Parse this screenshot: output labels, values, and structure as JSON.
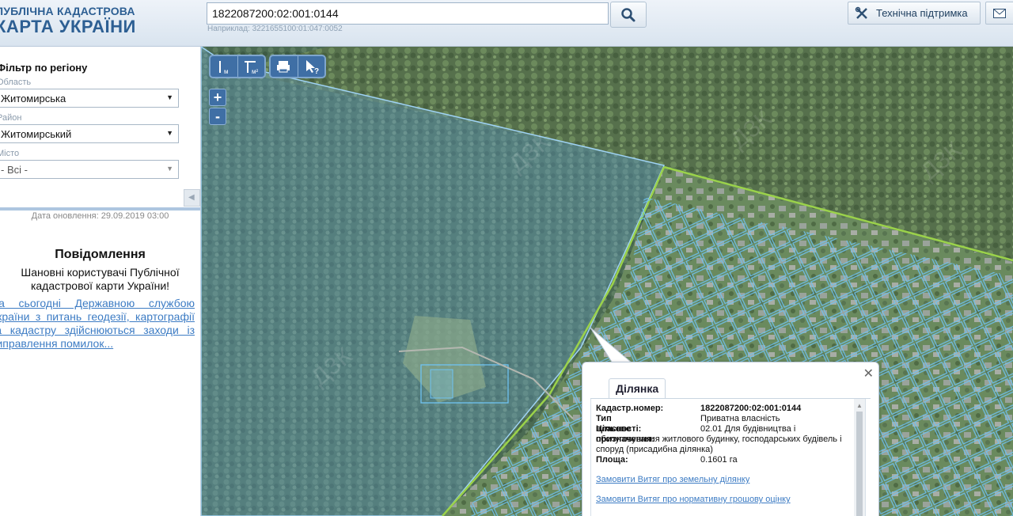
{
  "header": {
    "logo_line1": "ПУБЛІЧНА КАДАСТРОВА",
    "logo_line2": "КАРТА УКРАЇНИ",
    "search_value": "1822087200:02:001:0144",
    "search_hint": "Наприклад: 3221655100:01:047:0052",
    "support_label": "Технічна підтримка"
  },
  "sidebar": {
    "filter_title": "Фільтр по регіону",
    "oblast_label": "Область",
    "oblast_value": "Житомирська",
    "rayon_label": "Район",
    "rayon_value": "Житомирський",
    "misto_label": "Місто",
    "misto_value": "- Всі -",
    "update_date": "Дата оновлення: 29.09.2019 03:00",
    "notice_title": "Повідомлення",
    "notice_body": "Шановні користувачі Публічної кадастрової карти України!",
    "notice_link": "На сьогодні Державною службою України з питань геодезії, картографії та кадастру здійснюються заходи із виправлення помилок..."
  },
  "map_tools": {
    "measure_length": "м",
    "measure_area": "м²",
    "zoom_in": "+",
    "zoom_out": "-"
  },
  "popup": {
    "tab_label": "Ділянка",
    "cadastral_key": "Кадастр.номер:",
    "cadastral_value": "1822087200:02:001:0144",
    "ownership_key": "Тип власності:",
    "ownership_value": "Приватна власність",
    "purpose_key": "Цільове призначення:",
    "purpose_value_1": "02.01 Для будівництва і",
    "purpose_value_2": "обслуговування житлового будинку, господарських будівель і",
    "purpose_value_3": "споруд (присадибна ділянка)",
    "area_key": "Площа:",
    "area_value": "0.1601 га",
    "link_1": "Замовити Витяг про земельну ділянку",
    "link_2": "Замовити Витяг про нормативну грошову оцінку"
  }
}
